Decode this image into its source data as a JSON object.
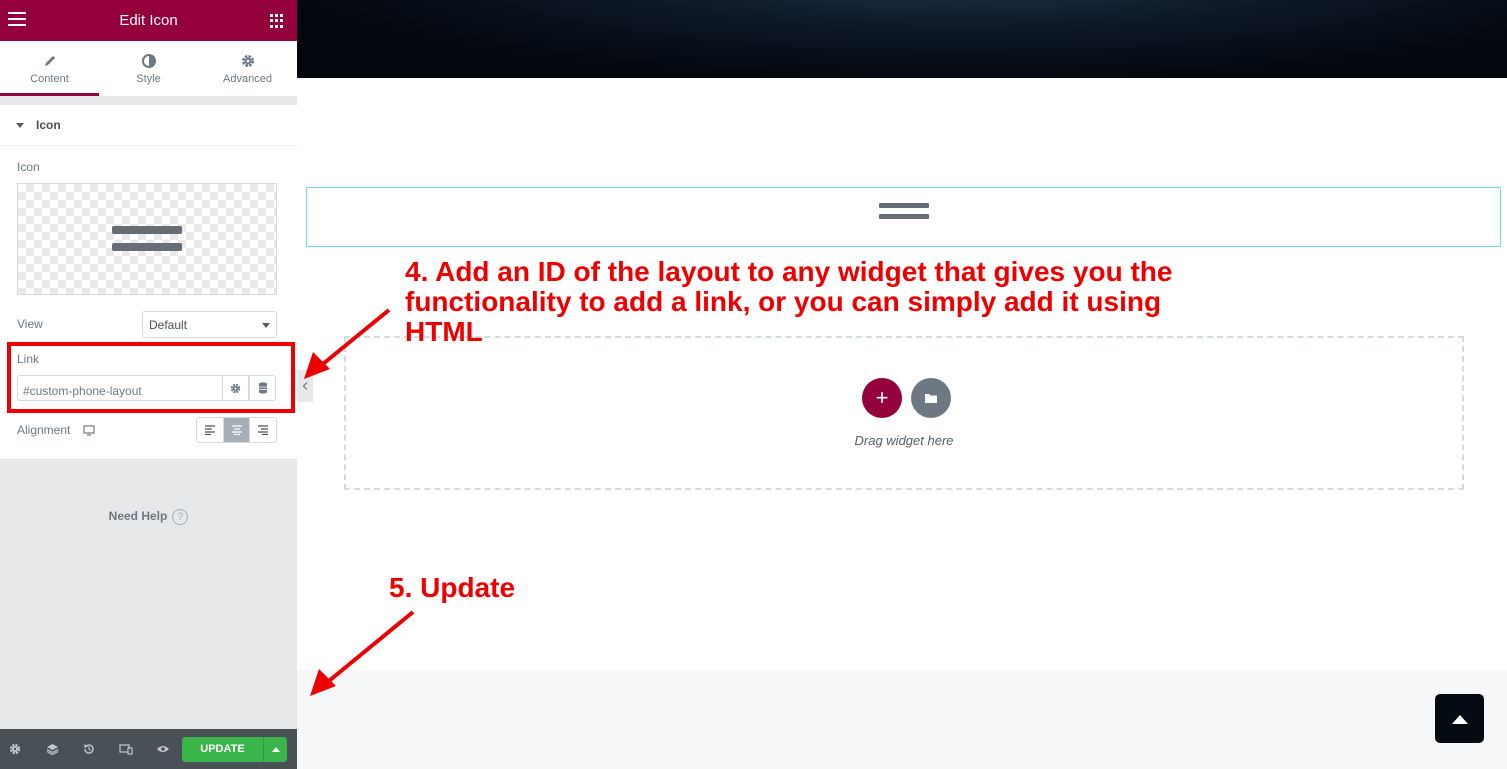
{
  "panel": {
    "header_title": "Edit Icon",
    "tabs": [
      {
        "label": "Content",
        "icon": "pencil-icon",
        "active": true
      },
      {
        "label": "Style",
        "icon": "contrast-icon",
        "active": false
      },
      {
        "label": "Advanced",
        "icon": "gear-icon",
        "active": false
      }
    ],
    "section_title": "Icon",
    "icon_label": "Icon",
    "view_label": "View",
    "view_value": "Default",
    "link_label": "Link",
    "link_value": "#custom-phone-layout",
    "alignment_label": "Alignment",
    "alignment_options": [
      "left",
      "center",
      "right"
    ],
    "alignment_selected": "center",
    "need_help": "Need Help",
    "help_glyph": "?"
  },
  "footer": {
    "icons": [
      "settings-icon",
      "layers-icon",
      "history-icon",
      "responsive-icon",
      "preview-eye-icon"
    ],
    "update_label": "UPDATE"
  },
  "canvas": {
    "add_glyph": "+",
    "drag_text": "Drag widget here"
  },
  "annotations": {
    "step4": "4. Add an ID of the layout to any widget that gives you the functionality to add a link, or you can simply add it using HTML",
    "step5": "5. Update"
  },
  "colors": {
    "brand": "#93003c",
    "update_green": "#39b54a",
    "annotation_red": "#ee0000",
    "widget_outline": "#71d7f7"
  }
}
